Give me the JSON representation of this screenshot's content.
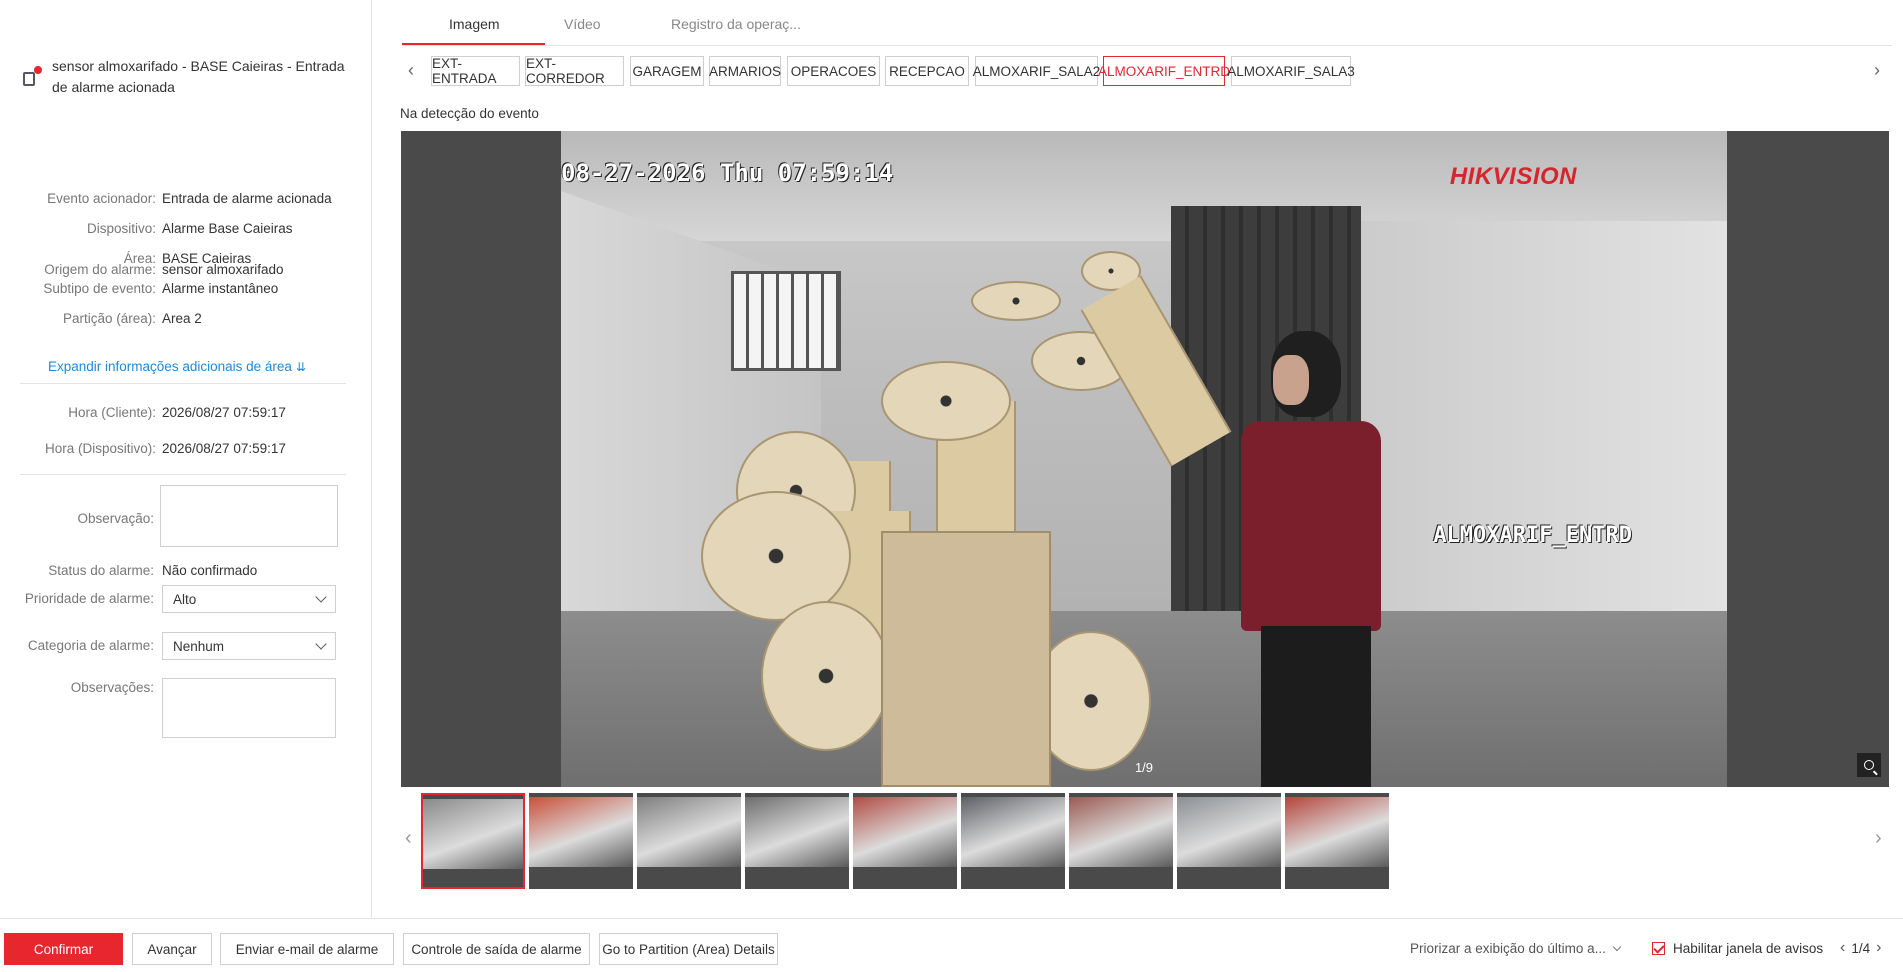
{
  "alarm": {
    "title": "sensor almoxarifado  - BASE Caieiras - Entrada de alarme acionada",
    "icon": "alarm-input-icon"
  },
  "details": [
    {
      "label": "Origem do alarme:",
      "value": "sensor almoxarifado"
    },
    {
      "label": "Evento acionador:",
      "value": "Entrada de alarme acionada"
    },
    {
      "label": "Dispositivo:",
      "value": "Alarme Base Caieiras"
    },
    {
      "label": "Área:",
      "value": "BASE Caieiras"
    },
    {
      "label": "Subtipo de evento:",
      "value": "Alarme instantâneo"
    },
    {
      "label": "Partição (área):",
      "value": "Area 2"
    }
  ],
  "expand_link": "Expandir informações adicionais de área",
  "times": [
    {
      "label": "Hora (Cliente):",
      "value": "2026/08/27 07:59:17"
    },
    {
      "label": "Hora (Dispositivo):",
      "value": "2026/08/27 07:59:17"
    }
  ],
  "form": {
    "observacao_label": "Observação:",
    "status_label": "Status do alarme:",
    "status_value": "Não confirmado",
    "priority_label": "Prioridade de alarme:",
    "priority_value": "Alto",
    "category_label": "Categoria de alarme:",
    "category_value": "Nenhum",
    "observacoes_label": "Observações:"
  },
  "tabs": [
    {
      "label": "Imagem",
      "active": true
    },
    {
      "label": "Vídeo",
      "active": false
    },
    {
      "label": "Registro da operaç...",
      "active": false
    }
  ],
  "cameras": [
    {
      "label": "EXT-ENTRADA",
      "active": false
    },
    {
      "label": "EXT-CORREDOR",
      "active": false
    },
    {
      "label": "GARAGEM",
      "active": false
    },
    {
      "label": "ARMARIOS",
      "active": false
    },
    {
      "label": "OPERACOES",
      "active": false
    },
    {
      "label": "RECEPCAO",
      "active": false
    },
    {
      "label": "ALMOXARIF_SALA2",
      "active": false
    },
    {
      "label": "ALMOXARIF_ENTRD",
      "active": true
    },
    {
      "label": "ALMOXARIF_SALA3",
      "active": false
    }
  ],
  "viewer": {
    "caption": "Na detecção do evento",
    "osd_timestamp": "08-27-2026 Thu 07:59:14",
    "osd_brand": "HIKVISION",
    "osd_camera": "ALMOXARIF_ENTRD",
    "page_indicator": "1/9"
  },
  "thumbnails": {
    "count": 9,
    "active_index": 0,
    "colors": [
      "#8a8a8a",
      "#c9503a",
      "#7e7e7e",
      "#6d6d6d",
      "#b24c44",
      "#5d6066",
      "#9a5a52",
      "#8b8f94",
      "#b5443c"
    ]
  },
  "bottom": {
    "confirm": "Confirmar",
    "advance": "Avançar",
    "email": "Enviar e-mail de alarme",
    "output_control": "Controle de saída de alarme",
    "partition_details": "Go to Partition (Area) Details",
    "prioritize": "Priorizar a exibição do último a...",
    "enable_window": "Habilitar janela de avisos",
    "pager": "1/4"
  },
  "colors": {
    "accent": "#e8262d",
    "link": "#1a8be5"
  }
}
